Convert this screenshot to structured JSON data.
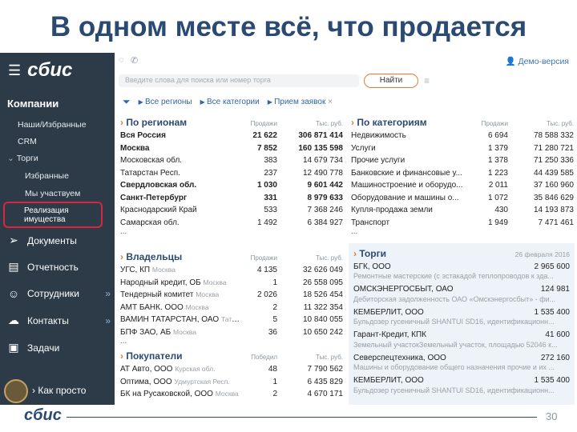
{
  "title": "В одном месте всё, что продается",
  "sidebar": {
    "logo": "сбис",
    "section": "Компании",
    "subitems": [
      "Наши/Избранные",
      "CRM",
      "Торги",
      "Избранные",
      "Мы участвуем"
    ],
    "active": "Реализация имущества",
    "main": [
      {
        "label": "Документы",
        "icon": "paper-plane-icon"
      },
      {
        "label": "Отчетность",
        "icon": "report-icon"
      },
      {
        "label": "Сотрудники",
        "icon": "people-icon"
      },
      {
        "label": "Контакты",
        "icon": "chat-icon"
      },
      {
        "label": "Задачи",
        "icon": "clipboard-icon"
      }
    ],
    "bottom": "Как просто"
  },
  "topbar": {
    "demo": "Демо-версия"
  },
  "search": {
    "placeholder": "Введите слова для поиска или номер торга",
    "button": "Найти"
  },
  "filters": [
    "Все регионы",
    "Все категории",
    "Прием заявок"
  ],
  "regions": {
    "title": "По регионам",
    "col1": "Продажи",
    "col2": "Тыс. руб.",
    "rows": [
      {
        "name": "Вся Россия",
        "v1": "21 622",
        "v2": "306 871 414",
        "bold": true
      },
      {
        "name": "Москва",
        "v1": "7 852",
        "v2": "160 135 598",
        "bold": true
      },
      {
        "name": "Московская обл.",
        "v1": "383",
        "v2": "14 679 734",
        "bold": false
      },
      {
        "name": "Татарстан Респ.",
        "v1": "237",
        "v2": "12 490 778",
        "bold": false
      },
      {
        "name": "Свердловская обл.",
        "v1": "1 030",
        "v2": "9 601 442",
        "bold": true
      },
      {
        "name": "Санкт-Петербург",
        "v1": "331",
        "v2": "8 979 633",
        "bold": true
      },
      {
        "name": "Краснодарский Край",
        "v1": "533",
        "v2": "7 368 246",
        "bold": false
      },
      {
        "name": "Самарская обл.",
        "v1": "1 492",
        "v2": "6 384 927",
        "bold": false
      }
    ]
  },
  "categories": {
    "title": "По категориям",
    "col1": "Продажи",
    "col2": "Тыс. руб.",
    "rows": [
      {
        "name": "Недвижимость",
        "v1": "6 694",
        "v2": "78 588 332"
      },
      {
        "name": "Услуги",
        "v1": "1 379",
        "v2": "71 280 721"
      },
      {
        "name": "Прочие услуги",
        "v1": "1 378",
        "v2": "71 250 336"
      },
      {
        "name": "Банковские и финансовые у...",
        "v1": "1 223",
        "v2": "44 439 585"
      },
      {
        "name": "Машиностроение и оборудо...",
        "v1": "2 011",
        "v2": "37 160 960"
      },
      {
        "name": "Оборудование и машины о...",
        "v1": "1 072",
        "v2": "35 846 629"
      },
      {
        "name": "Купля-продажа земли",
        "v1": "430",
        "v2": "14 193 873"
      },
      {
        "name": "Транспорт",
        "v1": "1 949",
        "v2": "7 471 461"
      }
    ]
  },
  "owners": {
    "title": "Владельцы",
    "col1": "Продажи",
    "col2": "Тыс. руб.",
    "rows": [
      {
        "name": "УГС, КП",
        "region": "Москва",
        "v1": "4 135",
        "v2": "32 626 049"
      },
      {
        "name": "Народный кредит, ОБ",
        "region": "Москва",
        "v1": "1",
        "v2": "26 558 095"
      },
      {
        "name": "Тендерный комитет",
        "region": "Москва",
        "v1": "2 026",
        "v2": "18 526 454"
      },
      {
        "name": "АМТ БАНК. ООО",
        "region": "Москва",
        "v1": "2",
        "v2": "11 322 354"
      },
      {
        "name": "ВАМИН ТАТАРСТАН, ОАО",
        "region": "Татарст...",
        "v1": "5",
        "v2": "10 840 055"
      },
      {
        "name": "БПФ ЗАО, АБ",
        "region": "Москва",
        "v1": "36",
        "v2": "10 650 242"
      }
    ]
  },
  "buyers": {
    "title": "Покупатели",
    "col1": "Победил",
    "col2": "Тыс. руб.",
    "rows": [
      {
        "name": "АТ Авто, ООО",
        "region": "Курская обл.",
        "v1": "48",
        "v2": "7 790 562"
      },
      {
        "name": "Оптима, ООО",
        "region": "Удмуртская Респ.",
        "v1": "1",
        "v2": "6 435 829"
      },
      {
        "name": "БК на Русаковской, ООО",
        "region": "Москва",
        "v1": "2",
        "v2": "4 670 171"
      }
    ]
  },
  "torgi": {
    "title": "Торги",
    "date": "26 февраля 2016",
    "items": [
      {
        "name": "БГК, ООО",
        "value": "2 965 600",
        "desc": "Ремонтные мастерские (с эстакадой теплопроводов к зда..."
      },
      {
        "name": "ОМСКЭНЕРГОСБЫТ, ОАО",
        "value": "124 981",
        "desc": "Дебиторская задолженность ОАО «Омскэнергосбыт» - фи..."
      },
      {
        "name": "КЕМБЕРЛИТ, ООО",
        "value": "1 535 400",
        "desc": "Бульдозер гусеничный SHANTUI SD16, идентификационн..."
      },
      {
        "name": "Гарант-Кредит, КПК",
        "value": "41 600",
        "desc": "Земельный участокЗемельный участок, площадью 52046 к..."
      },
      {
        "name": "Северспецтехника, ООО",
        "value": "272 160",
        "desc": "Машины и оборудование общего назначения прочие и их ..."
      },
      {
        "name": "КЕМБЕРЛИТ, ООО",
        "value": "1 535 400",
        "desc": "Бульдозер гусеничный SHANTUI SD16, идентификационн..."
      }
    ]
  },
  "footer": {
    "logo": "сбис",
    "page": "30"
  }
}
